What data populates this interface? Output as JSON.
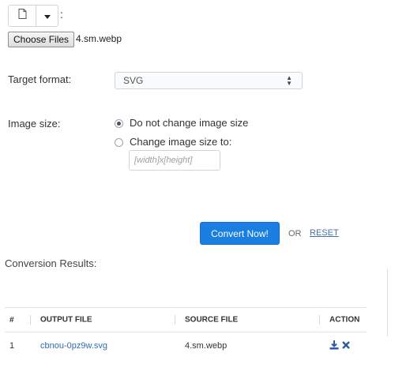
{
  "file_type_group": {
    "doc_icon": "file-icon",
    "caret_icon": "caret-down-icon",
    "colon": ":"
  },
  "file_input": {
    "button_label": "Choose Files",
    "file_name": "4.sm.webp"
  },
  "target_format": {
    "label": "Target format:",
    "selected": "SVG"
  },
  "image_size": {
    "label": "Image size:",
    "options": [
      {
        "label": "Do not change image size",
        "checked": true
      },
      {
        "label": "Change image size to:",
        "checked": false
      }
    ],
    "size_placeholder": "[width]x[height]"
  },
  "actions": {
    "convert_label": "Convert Now!",
    "or_text": "OR",
    "reset_label": "RESET"
  },
  "results": {
    "title": "Conversion Results:",
    "columns": [
      "#",
      "OUTPUT FILE",
      "SOURCE FILE",
      "ACTION"
    ],
    "rows": [
      {
        "index": "1",
        "output_file": "cbnou-0pz9w.svg",
        "source_file": "4.sm.webp"
      }
    ]
  },
  "colors": {
    "primary": "#1a7fe0",
    "link": "#2f6db5",
    "action_icon": "#2a5d9f"
  }
}
